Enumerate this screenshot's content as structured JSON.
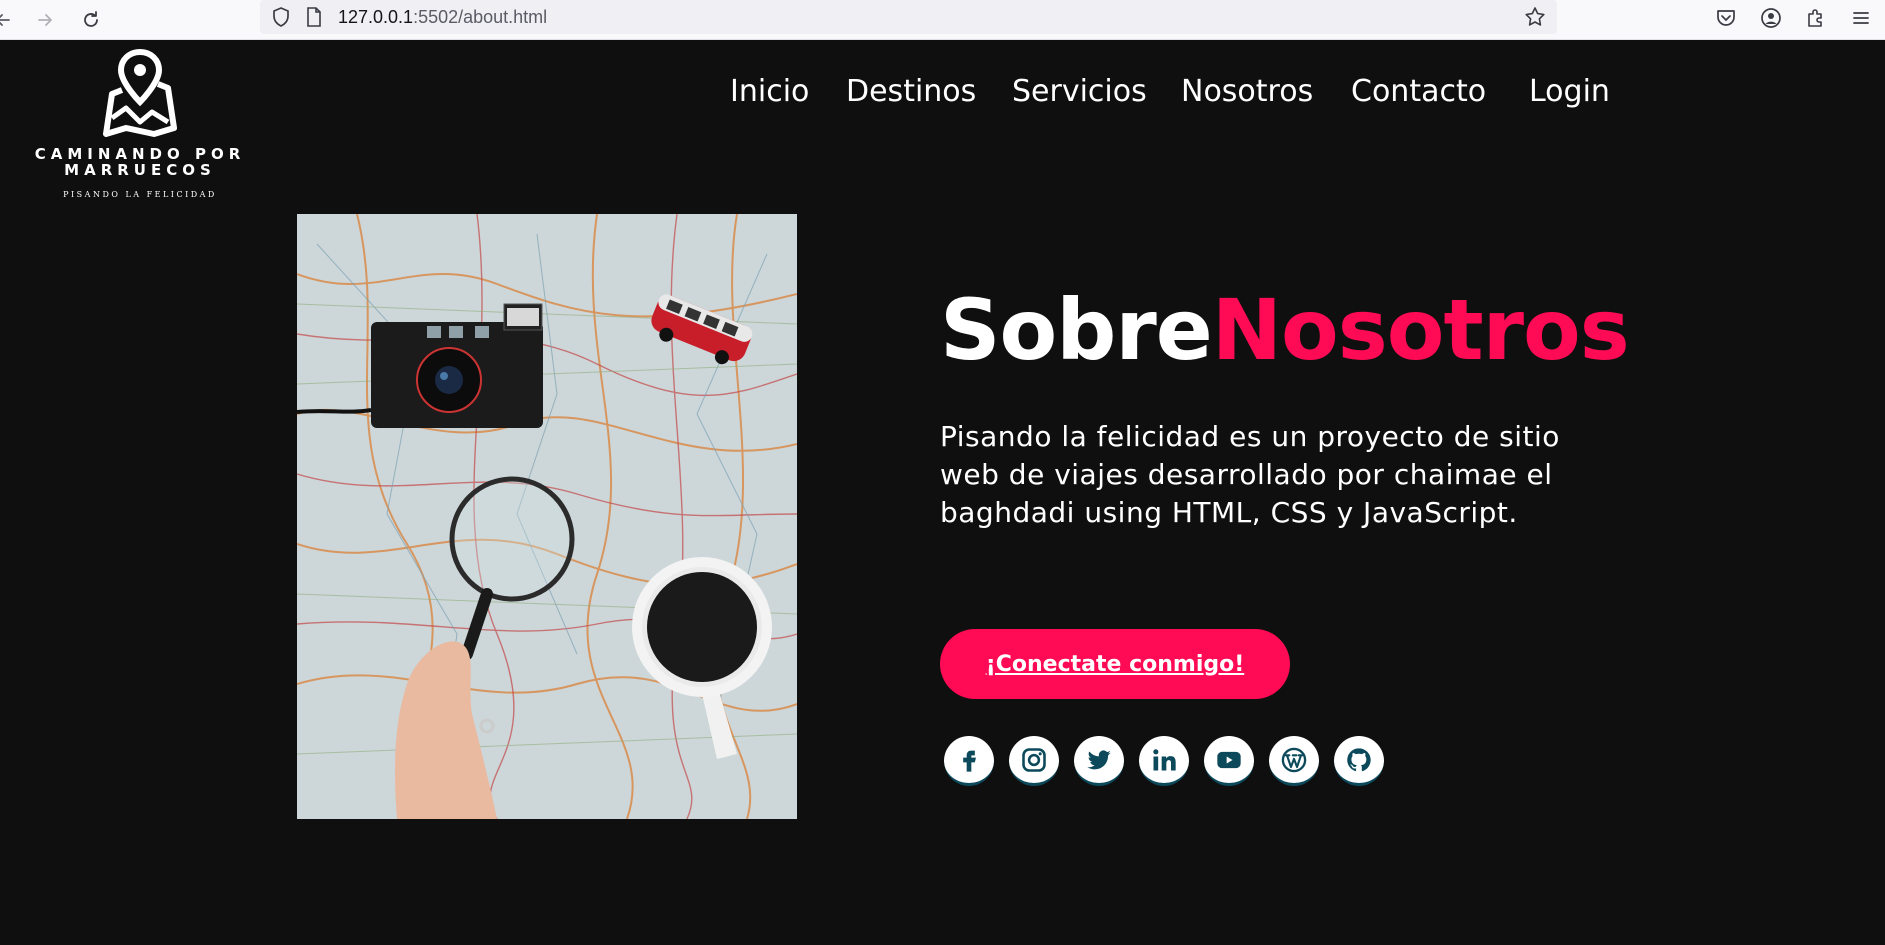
{
  "browser": {
    "url_host": "127.0.0.1",
    "url_rest": ":5502/about.html"
  },
  "logo": {
    "brand_line1": "CAMINANDO POR",
    "brand_line2": "MARRUECOS",
    "tagline": "PISANDO LA FELICIDAD"
  },
  "nav": {
    "items": [
      {
        "label": "Inicio"
      },
      {
        "label": "Destinos"
      },
      {
        "label": "Servicios"
      },
      {
        "label": "Nosotros"
      },
      {
        "label": "Contacto"
      },
      {
        "label": "Login"
      }
    ]
  },
  "about": {
    "title_part1": "Sobre",
    "title_part2": "Nosotros",
    "description": "Pisando la felicidad es un proyecto de sitio web de viajes desarrollado por chaimae el baghdadi using HTML, CSS y JavaScript.",
    "cta_label": "¡Conectate conmigo!"
  },
  "socials": [
    {
      "icon": "facebook-icon"
    },
    {
      "icon": "instagram-icon"
    },
    {
      "icon": "twitter-icon"
    },
    {
      "icon": "linkedin-icon"
    },
    {
      "icon": "youtube-icon"
    },
    {
      "icon": "wordpress-icon"
    },
    {
      "icon": "github-icon"
    }
  ],
  "colors": {
    "background": "#0f0f10",
    "accent": "#ff0a54",
    "text": "#ffffff",
    "social_icon": "#0c4a5b"
  }
}
